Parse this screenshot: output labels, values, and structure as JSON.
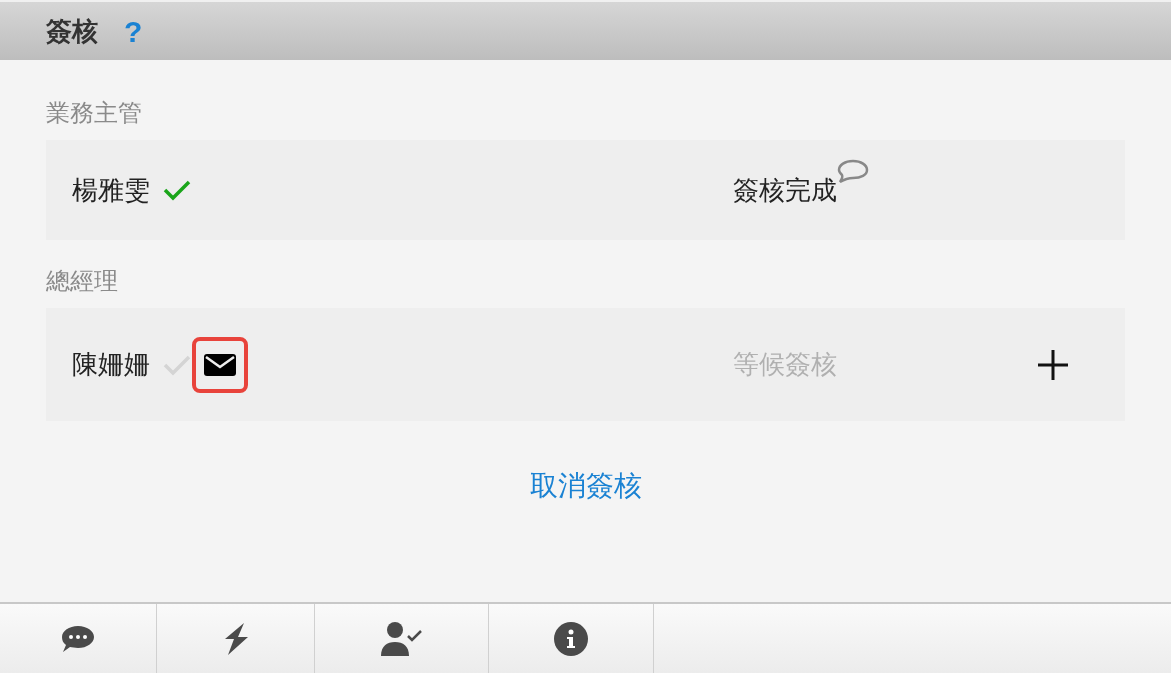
{
  "header": {
    "title": "簽核",
    "help": "?"
  },
  "stages": [
    {
      "label": "業務主管",
      "signer": "楊雅雯",
      "approved": true,
      "status": "簽核完成",
      "pending": false,
      "has_comment": true,
      "has_mail": false,
      "can_add": false
    },
    {
      "label": "總經理",
      "signer": "陳姍姍",
      "approved": false,
      "status": "等候簽核",
      "pending": true,
      "has_comment": false,
      "has_mail": true,
      "mail_highlighted": true,
      "can_add": true
    }
  ],
  "cancel_link": "取消簽核"
}
